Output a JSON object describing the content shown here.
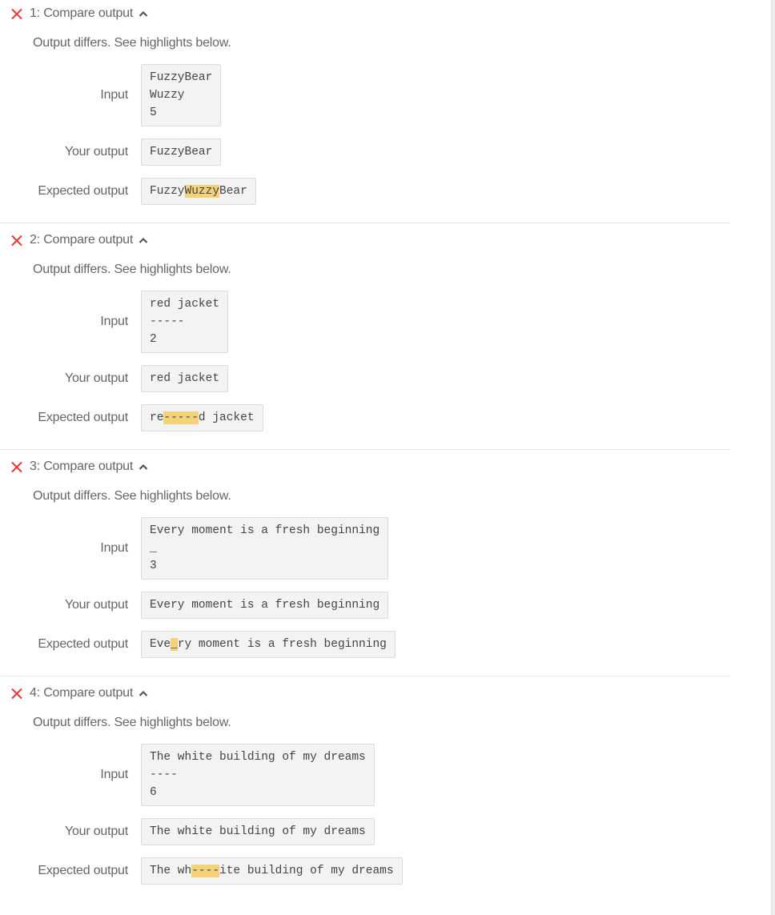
{
  "labels": {
    "input": "Input",
    "your_output": "Your output",
    "expected_output": "Expected output"
  },
  "colors": {
    "fail_icon": "#e53935",
    "highlight": "#f3d27a"
  },
  "tests": [
    {
      "title": "1: Compare output",
      "status_icon": "x-icon",
      "message": "Output differs. See highlights below.",
      "input_lines": [
        "FuzzyBear",
        "Wuzzy",
        "5"
      ],
      "your_output": "FuzzyBear",
      "expected": {
        "before": "Fuzzy",
        "highlight": "Wuzzy",
        "after": "Bear"
      }
    },
    {
      "title": "2: Compare output",
      "status_icon": "x-icon",
      "message": "Output differs. See highlights below.",
      "input_lines": [
        "red jacket",
        "-----",
        "2"
      ],
      "your_output": "red jacket",
      "expected": {
        "before": "re",
        "highlight": "-----",
        "after": "d jacket"
      }
    },
    {
      "title": "3: Compare output",
      "status_icon": "x-icon",
      "message": "Output differs. See highlights below.",
      "input_lines": [
        "Every moment is a fresh beginning",
        "_",
        "3"
      ],
      "your_output": "Every moment is a fresh beginning",
      "expected": {
        "before": "Eve",
        "highlight": "_",
        "after": "ry moment is a fresh beginning"
      }
    },
    {
      "title": "4: Compare output",
      "status_icon": "x-icon",
      "message": "Output differs. See highlights below.",
      "input_lines": [
        "The white building of my dreams",
        "----",
        "6"
      ],
      "your_output": "The white building of my dreams",
      "expected": {
        "before": "The wh",
        "highlight": "----",
        "after": "ite building of my dreams"
      }
    }
  ]
}
